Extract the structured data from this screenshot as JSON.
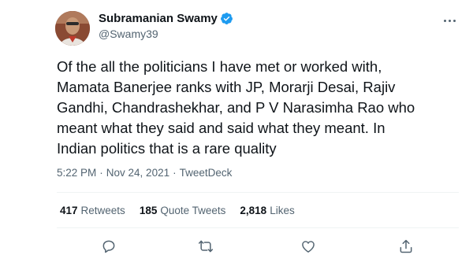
{
  "author": {
    "name": "Subramanian Swamy",
    "handle": "@Swamy39",
    "verified": true,
    "avatar_icon": "profile-photo"
  },
  "tweet": {
    "text": "Of the all the politicians I have met or worked with,\nMamata Banerjee ranks with JP, Morarji Desai, Rajiv\nGandhi, Chandrashekhar, and P V Narasimha Rao who\nmeant what they said and said what they meant. In\nIndian politics that is a rare quality",
    "time": "5:22 PM",
    "separator1": "·",
    "date": "Nov 24, 2021",
    "separator2": "·",
    "source": "TweetDeck"
  },
  "stats": {
    "retweets_count": "417",
    "retweets_label": "Retweets",
    "quotes_count": "185",
    "quotes_label": "Quote Tweets",
    "likes_count": "2,818",
    "likes_label": "Likes"
  },
  "actions": [
    "reply-icon",
    "retweet-icon",
    "like-icon",
    "share-icon"
  ],
  "colors": {
    "text": "#0f1419",
    "secondary": "#536471",
    "verified": "#1d9bf0",
    "divider": "#eff3f4"
  }
}
